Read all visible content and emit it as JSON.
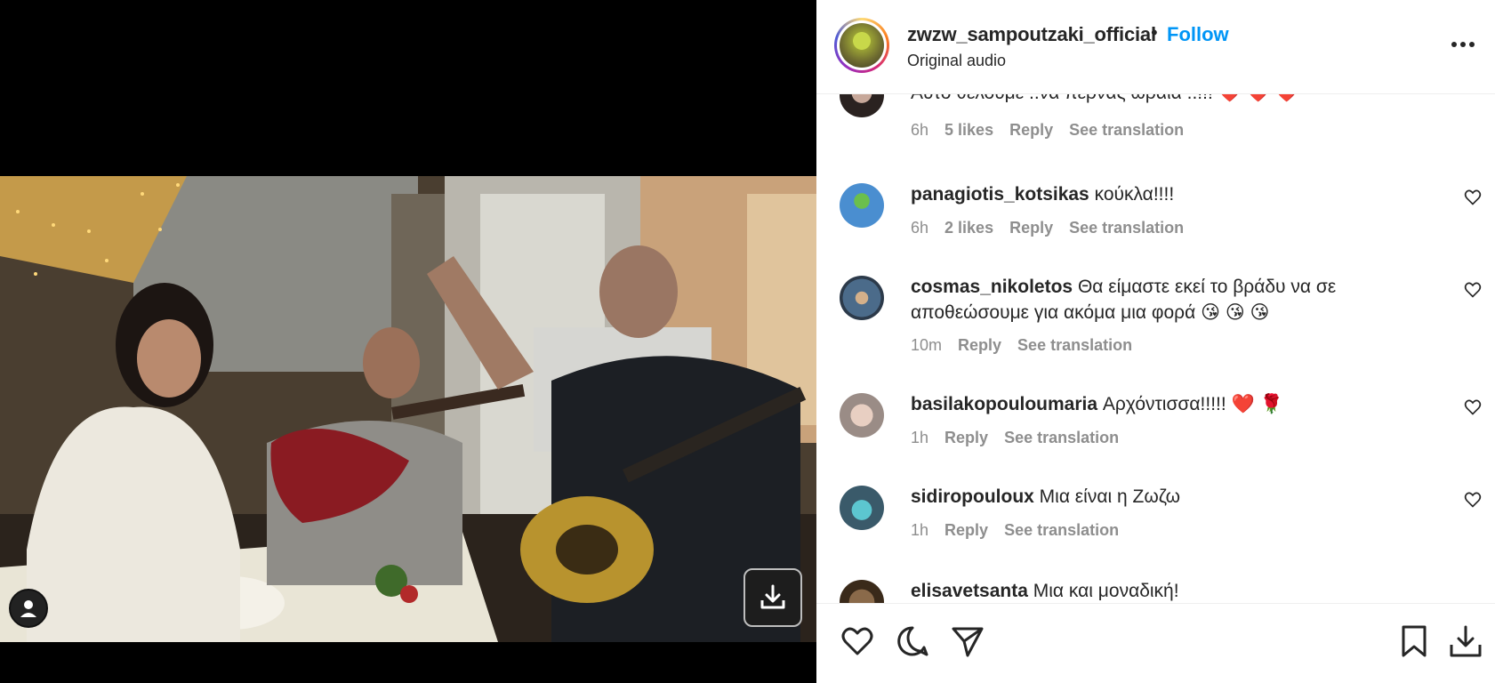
{
  "header": {
    "username": "zwzw_sampoutzaki_official",
    "separator": "•",
    "follow_label": "Follow",
    "audio_label": "Original audio"
  },
  "comments": [
    {
      "username": "",
      "text": "Αυτό θέλουμε ..να περνάς ωραία ..!!! ❤️ ❤️ ❤️",
      "time": "6h",
      "likes": "5 likes",
      "reply": "Reply",
      "translate": "See translation"
    },
    {
      "username": "panagiotis_kotsikas",
      "text": "κούκλα!!!!",
      "time": "6h",
      "likes": "2 likes",
      "reply": "Reply",
      "translate": "See translation"
    },
    {
      "username": "cosmas_nikoletos",
      "text": "Θα είμαστε εκεί το βράδυ να σε αποθεώσουμε για ακόμα μια φορά 😘 😘 😘",
      "time": "10m",
      "reply": "Reply",
      "translate": "See translation"
    },
    {
      "username": "basilakopouloumaria",
      "text": "Αρχόντισσα!!!!! ❤️ 🌹",
      "time": "1h",
      "reply": "Reply",
      "translate": "See translation"
    },
    {
      "username": "sidiropouloux",
      "text": "Μια είναι η Ζωζω",
      "time": "1h",
      "reply": "Reply",
      "translate": "See translation"
    },
    {
      "username": "elisavetsanta",
      "text": "Μια και μοναδική!"
    }
  ],
  "icons": {
    "like": "heart-icon",
    "comment": "comment-icon",
    "share": "share-icon",
    "save": "bookmark-icon",
    "download": "download-icon",
    "more": "more-icon"
  },
  "colors": {
    "follow": "#0095f6",
    "text": "#262626",
    "meta": "#8e8e8e"
  }
}
